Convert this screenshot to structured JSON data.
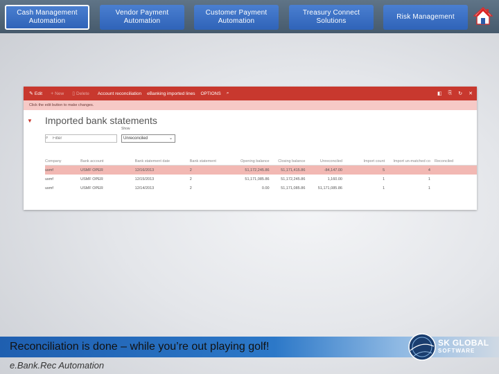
{
  "nav": {
    "items": [
      {
        "label": "Cash Management\nAutomation",
        "active": true
      },
      {
        "label": "Vendor  Payment\nAutomation",
        "active": false
      },
      {
        "label": "Customer Payment\nAutomation",
        "active": false
      },
      {
        "label": "Treasury Connect\nSolutions",
        "active": false
      },
      {
        "label": "Risk Management",
        "active": false
      }
    ],
    "home_icon": "home-icon"
  },
  "app": {
    "toolbar": {
      "edit": "Edit",
      "new": "New",
      "delete": "Delete",
      "account_reconciliation": "Account reconciliation",
      "ebanking": "eBanking imported lines",
      "options": "OPTIONS"
    },
    "message": "Click the edit button to make changes.",
    "page_title": "Imported bank statements",
    "filter_placeholder": "Filter",
    "show_label": "Show",
    "show_value": "Unreconciled",
    "table": {
      "headers": [
        "Company",
        "Bank account",
        "Bank statement date",
        "Bank statement",
        "Opening balance",
        "Closing balance",
        "Unreconciled",
        "Import count",
        "Import un-matched co",
        "Reconciled"
      ],
      "rows": [
        [
          "usmf",
          "USMF OPER",
          "12/16/2013",
          "2",
          "51,172,245.86",
          "51,171,415.86",
          "-84,147.00",
          "5",
          "4",
          ""
        ],
        [
          "usmf",
          "USMF OPER",
          "12/15/2013",
          "2",
          "51,171,085.86",
          "51,172,245.86",
          "1,160.00",
          "1",
          "1",
          ""
        ],
        [
          "usmf",
          "USMF OPER",
          "12/14/2013",
          "2",
          "0.00",
          "51,171,085.86",
          "51,171,085.86",
          "1",
          "1",
          ""
        ]
      ]
    }
  },
  "footer": {
    "banner_text": "Reconciliation is done – while you’re out playing golf!",
    "subtitle": "e.Bank.Rec Automation",
    "logo_line1": "SK GLOBAL",
    "logo_line2": "SOFTWARE",
    "logo_mark": "skg"
  },
  "colors": {
    "nav_button": "#3a6fc4",
    "app_toolbar": "#c8382e",
    "selected_row": "#f2b8b3",
    "banner": "#2c78c8"
  }
}
